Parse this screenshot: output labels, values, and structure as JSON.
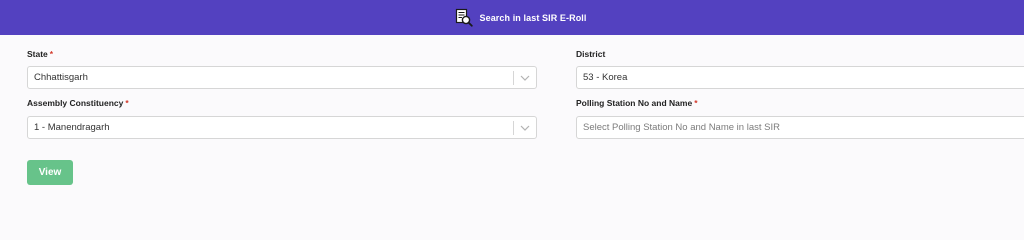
{
  "header": {
    "title": "Search in last SIR E-Roll",
    "icon": "document-search-icon",
    "background": "#5341c0"
  },
  "form": {
    "state": {
      "label": "State",
      "required_mark": "*",
      "value": "Chhattisgarh"
    },
    "district": {
      "label": "District",
      "value": "53 - Korea"
    },
    "assembly_constituency": {
      "label": "Assembly Constituency",
      "required_mark": "*",
      "value": "1 - Manendragarh"
    },
    "polling_station": {
      "label": "Polling Station No and Name",
      "required_mark": "*",
      "placeholder": "Select Polling Station No and Name in last SIR"
    }
  },
  "actions": {
    "view_label": "View",
    "view_color": "#67c38a"
  },
  "colors": {
    "required": "#d33a2c",
    "field_border": "#d6d6d6"
  }
}
